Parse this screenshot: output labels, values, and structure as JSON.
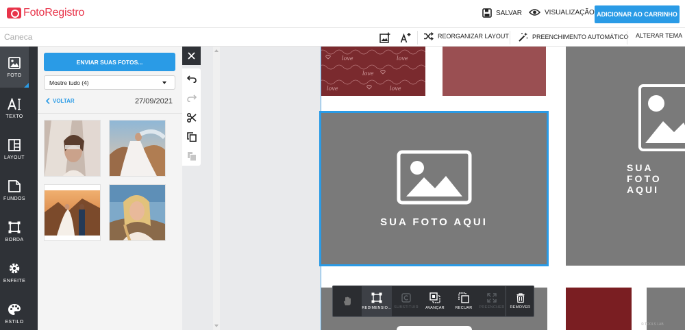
{
  "header": {
    "brand": "FotoRegistro",
    "save_label": "SALVAR",
    "preview_label": "VISUALIZAÇÃO",
    "cart_label": "ADICIONAR AO CARRINHO"
  },
  "subbar": {
    "product_name": "Caneca",
    "reorganize_label": "REORGANIZAR LAYOUT",
    "autofill_label": "PREENCHIMENTO AUTOMÁTICO",
    "theme_label": "ALTERAR TEMA"
  },
  "sidebar": {
    "items": [
      {
        "label": "FOTO",
        "icon": "image-icon",
        "active": true
      },
      {
        "label": "TEXTO",
        "icon": "text-icon"
      },
      {
        "label": "LAYOUT",
        "icon": "layout-icon"
      },
      {
        "label": "FUNDOS",
        "icon": "background-icon"
      },
      {
        "label": "BORDA",
        "icon": "border-icon"
      },
      {
        "label": "ENFEITE",
        "icon": "gear-icon"
      },
      {
        "label": "ESTILO",
        "icon": "palette-icon"
      }
    ]
  },
  "photo_panel": {
    "upload_label": "ENVIAR SUAS FOTOS...",
    "filter_selected": "Mostre tudo (4)",
    "back_label": "VOLTAR",
    "date": "27/09/2021",
    "photos": [
      "bride-veil-photo",
      "bride-cliff-photo",
      "couple-desert-photo",
      "woman-field-photo"
    ]
  },
  "canvas": {
    "placeholder_text": "SUA FOTO AQUI",
    "colors": {
      "pattern_red": "#7a2a2e",
      "dusty_red": "#9a4f52",
      "dark_red": "#7a1e22",
      "placeholder_gray": "#7a7a7a",
      "selection_blue": "#2a9be6"
    },
    "pattern_word": "love"
  },
  "bottom_toolbar": {
    "items": [
      {
        "label": "",
        "icon": "hand-icon"
      },
      {
        "label": "REDIMENSIO...",
        "icon": "resize-icon",
        "selected": true
      },
      {
        "label": "SUBSTITUIR",
        "icon": "replace-icon",
        "disabled": true
      },
      {
        "label": "AVANÇAR",
        "icon": "bring-forward-icon"
      },
      {
        "label": "RECUAR",
        "icon": "send-backward-icon"
      },
      {
        "label": "PREENCHER",
        "icon": "expand-icon",
        "disabled": true
      },
      {
        "label": "REMOVER",
        "icon": "trash-icon"
      }
    ]
  },
  "watermark": "© TOOLS LAB"
}
